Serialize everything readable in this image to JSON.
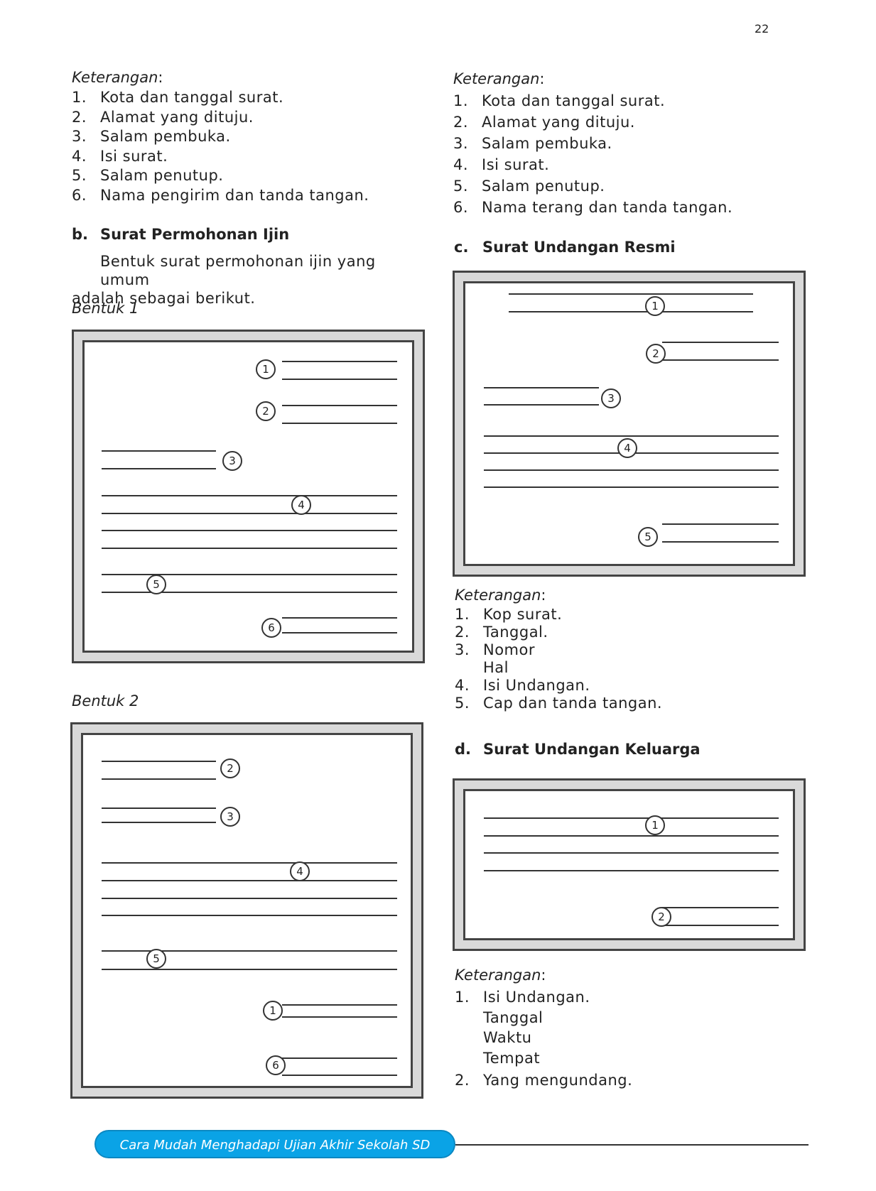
{
  "page_number": "22",
  "left": {
    "keterangan_label": "Keterangan",
    "items": [
      {
        "num": "1.",
        "text": "Kota dan tanggal surat."
      },
      {
        "num": "2.",
        "text": "Alamat yang dituju."
      },
      {
        "num": "3.",
        "text": "Salam pembuka."
      },
      {
        "num": "4.",
        "text": "Isi surat."
      },
      {
        "num": "5.",
        "text": "Salam penutup."
      },
      {
        "num": "6.",
        "text": "Nama pengirim dan tanda tangan."
      }
    ],
    "section_b": {
      "letter": "b.",
      "title": "Surat Permohonan Ijin",
      "paragraph_line1": "Bentuk surat permohonan ijin yang umum",
      "paragraph_line2": "adalah sebagai berikut.",
      "bentuk1": "Bentuk 1",
      "bentuk2": "Bentuk 2"
    }
  },
  "right": {
    "keterangan_label": "Keterangan",
    "items": [
      {
        "num": "1.",
        "text": "Kota dan tanggal surat."
      },
      {
        "num": "2.",
        "text": "Alamat yang dituju."
      },
      {
        "num": "3.",
        "text": "Salam pembuka."
      },
      {
        "num": "4.",
        "text": "Isi surat."
      },
      {
        "num": "5.",
        "text": "Salam penutup."
      },
      {
        "num": "6.",
        "text": "Nama terang dan tanda tangan."
      }
    ],
    "section_c": {
      "letter": "c.",
      "title": "Surat Undangan Resmi",
      "keterangan_label": "Keterangan",
      "items": [
        {
          "num": "1.",
          "text": "Kop surat."
        },
        {
          "num": "2.",
          "text": "Tanggal."
        },
        {
          "num": "3.",
          "text": "Nomor"
        },
        {
          "num": "",
          "text": "Hal"
        },
        {
          "num": "4.",
          "text": "Isi Undangan."
        },
        {
          "num": "5.",
          "text": "Cap dan tanda tangan."
        }
      ]
    },
    "section_d": {
      "letter": "d.",
      "title": "Surat Undangan Keluarga",
      "keterangan_label": "Keterangan",
      "items": [
        {
          "num": "1.",
          "text": "Isi Undangan."
        },
        {
          "num": "",
          "text": "Tanggal"
        },
        {
          "num": "",
          "text": "Waktu"
        },
        {
          "num": "",
          "text": "Tempat"
        },
        {
          "num": "2.",
          "text": "Yang mengundang."
        }
      ]
    }
  },
  "diagram_markers": {
    "bentuk1": [
      "1",
      "2",
      "3",
      "4",
      "5",
      "6"
    ],
    "bentuk2": [
      "2",
      "3",
      "4",
      "5",
      "1",
      "6"
    ],
    "undangan_resmi": [
      "1",
      "2",
      "3",
      "4",
      "5"
    ],
    "undangan_keluarga": [
      "1",
      "2"
    ]
  },
  "footer": {
    "text": "Cara Mudah Menghadapi Ujian Akhir Sekolah SD",
    "pill_color": "#0aa3e6"
  }
}
